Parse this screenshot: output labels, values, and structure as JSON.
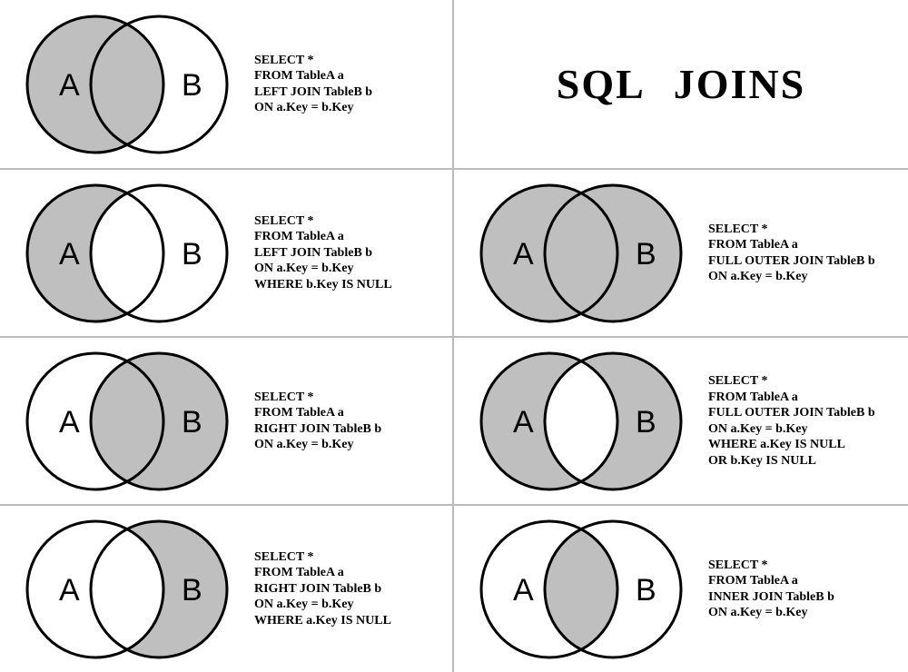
{
  "title": "SQL  JOINS",
  "labels": {
    "A": "A",
    "B": "B"
  },
  "colors": {
    "fill": "#bfbfbf",
    "stroke": "#000000",
    "bg": "#ffffff"
  },
  "cells": [
    {
      "venn": "left_full",
      "sql": "SELECT *\nFROM TableA a\nLEFT JOIN TableB b\nON a.Key = b.Key"
    },
    {
      "title": true
    },
    {
      "venn": "left_only",
      "sql": "SELECT *\nFROM TableA a\nLEFT JOIN TableB b\nON a.Key = b.Key\nWHERE b.Key IS NULL"
    },
    {
      "venn": "full",
      "sql": "SELECT *\nFROM TableA a\nFULL OUTER JOIN TableB b\nON a.Key = b.Key"
    },
    {
      "venn": "right_full",
      "sql": "SELECT *\nFROM TableA a\nRIGHT JOIN TableB b\nON a.Key = b.Key"
    },
    {
      "venn": "outer_only",
      "sql": "SELECT *\nFROM TableA a\nFULL OUTER JOIN TableB b\nON a.Key = b.Key\nWHERE a.Key IS NULL\nOR b.Key IS NULL"
    },
    {
      "venn": "right_only",
      "sql": "SELECT *\nFROM TableA a\nRIGHT JOIN TableB b\nON a.Key = b.Key\nWHERE a.Key IS NULL"
    },
    {
      "venn": "inner",
      "sql": "SELECT *\nFROM TableA a\nINNER JOIN TableB b\nON a.Key = b.Key"
    }
  ]
}
